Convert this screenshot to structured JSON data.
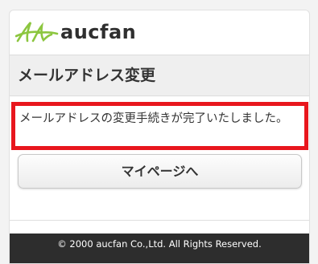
{
  "header": {
    "logo_text": "aucfan",
    "logo_icon": "aucfan-leaf-logo",
    "logo_color": "#8cc63f"
  },
  "page": {
    "title": "メールアドレス変更"
  },
  "message": {
    "text": "メールアドレスの変更手続きが完了いたしました。",
    "border_color": "#e8161d"
  },
  "actions": {
    "mypage_label": "マイページへ"
  },
  "footer": {
    "copyright": "© 2000 aucfan Co.,Ltd. All Rights Reserved."
  }
}
